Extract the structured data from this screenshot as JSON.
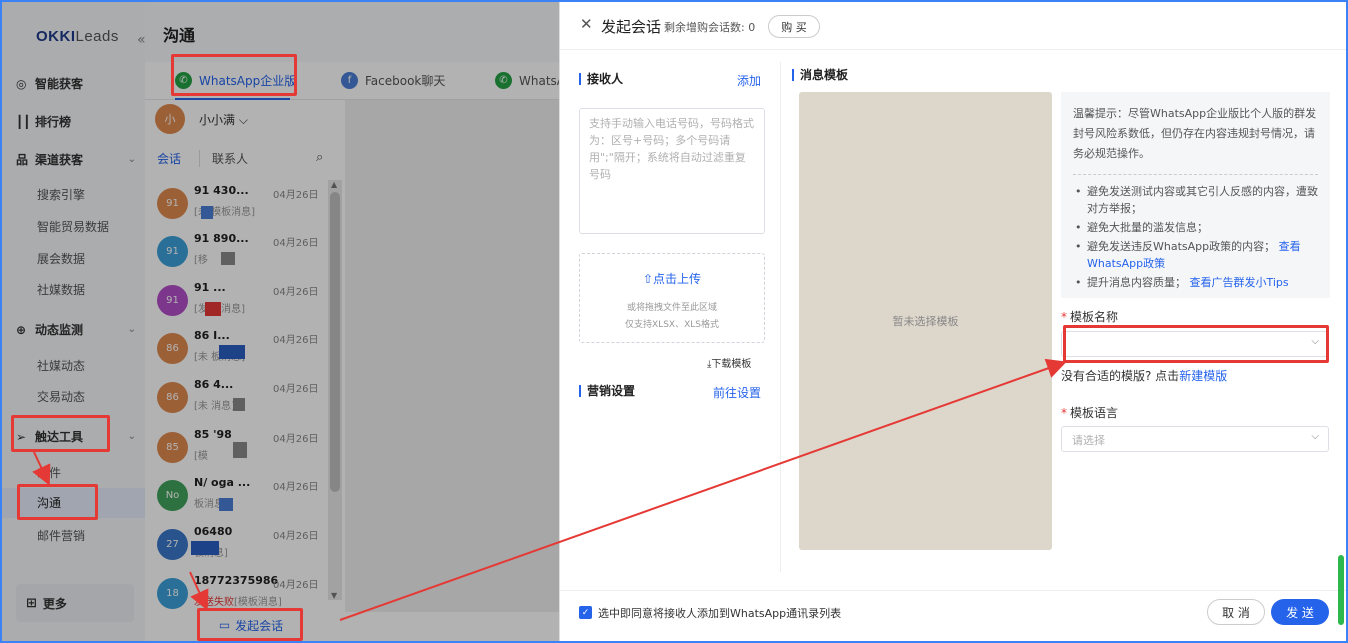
{
  "app": {
    "logo_main": "OKKI",
    "logo_sub": "Leads",
    "collapse": "«",
    "page_title": "沟通"
  },
  "sidebar": {
    "groups": [
      {
        "label": "智能获客",
        "icon": "target-icon"
      },
      {
        "label": "排行榜",
        "icon": "bar-chart-icon"
      },
      {
        "label": "渠道获客",
        "icon": "org-chart-icon"
      },
      {
        "label": "动态监测",
        "icon": "radar-icon"
      },
      {
        "label": "触达工具",
        "icon": "send-icon"
      }
    ],
    "channel_items": [
      "搜索引擎",
      "智能贸易数据",
      "展会数据",
      "社媒数据"
    ],
    "monitor_items": [
      "社媒动态",
      "交易动态"
    ],
    "reach_items": [
      "邮件",
      "沟通",
      "邮件营销"
    ],
    "more": "更多"
  },
  "tabs": [
    {
      "label": "WhatsApp企业版",
      "color": "#25a244"
    },
    {
      "label": "Facebook聊天",
      "color": "#4b7fd6"
    },
    {
      "label": "WhatsA",
      "color": "#25a244"
    }
  ],
  "user": {
    "avatar": "小",
    "name": "小小满 ⌵"
  },
  "subtabs": {
    "chat": "会话",
    "contacts": "联系人"
  },
  "conversations": [
    {
      "avatar": "91",
      "color": "#e08a4f",
      "name": "91      430...",
      "date": "04月26日",
      "preview": "[未     模板消息]"
    },
    {
      "avatar": "91",
      "color": "#3b9fd8",
      "name": "91      890...",
      "date": "04月26日",
      "preview": "[移"
    },
    {
      "avatar": "91",
      "color": "#b24ec7",
      "name": "91        ...",
      "date": "04月26日",
      "preview": "[发      板消息]"
    },
    {
      "avatar": "86",
      "color": "#e08a4f",
      "name": "86        I...",
      "date": "04月26日",
      "preview": "[未        板消息]"
    },
    {
      "avatar": "86",
      "color": "#e08a4f",
      "name": "86        4...",
      "date": "04月26日",
      "preview": "[未         消息]"
    },
    {
      "avatar": "85",
      "color": "#e08a4f",
      "name": "85        '98",
      "date": "04月26日",
      "preview": "[模"
    },
    {
      "avatar": "No",
      "color": "#3fa35b",
      "name": "N/      oga ...",
      "date": "04月26日",
      "preview": "         板消息]"
    },
    {
      "avatar": "27",
      "color": "#3b78c9",
      "name": "          06480",
      "date": "04月26日",
      "preview": "           板消息]"
    },
    {
      "avatar": "18",
      "color": "#3b9fd8",
      "name": "18772375986",
      "date": "04月26日",
      "preview_red": "发送失败",
      "preview": "[模板消息]"
    }
  ],
  "start_chat": "发起会话",
  "drawer": {
    "close": "✕",
    "title": "发起会话",
    "remaining": "剩余增购会话数: 0",
    "buy": "购 买",
    "recipients_title": "接收人",
    "add": "添加",
    "recipients_placeholder": "支持手动输入电话号码，号码格式为：区号+号码；多个号码请用\";\"隔开；系统将自动过滤重复号码",
    "upload_link": "点击上传",
    "upload_hint1": "或将拖拽文件至此区域",
    "upload_hint2": "仅支持XLSX、XLS格式",
    "download_template": "下载模板",
    "marketing_title": "营销设置",
    "goto_settings": "前往设置",
    "template_title": "消息模板",
    "no_template": "暂未选择模板",
    "tip_text": "温馨提示：尽管WhatsApp企业版比个人版的群发封号风险系数低，但仍存在内容违规封号情况，请务必规范操作。",
    "tip_items": [
      {
        "text": "避免发送测试内容或其它引人反感的内容，遭致对方举报；"
      },
      {
        "text": "避免大批量的滥发信息；"
      },
      {
        "text": "避免发送违反WhatsApp政策的内容；",
        "link": "查看WhatsApp政策"
      },
      {
        "text": "提升消息内容质量；",
        "link": "查看广告群发小Tips"
      }
    ],
    "template_name_label": "模板名称",
    "template_name_value": "",
    "no_template_hint": "没有合适的模版? 点击",
    "new_template": "新建模版",
    "template_lang_label": "模板语言",
    "template_lang_placeholder": "请选择",
    "agree": "选中即同意将接收人添加到WhatsApp通讯录列表",
    "cancel": "取 消",
    "send": "发 送"
  },
  "colors": {
    "accent": "#2563eb",
    "annotation": "#e53935"
  }
}
